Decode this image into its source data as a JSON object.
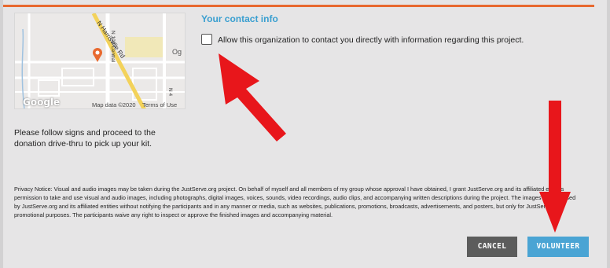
{
  "contact": {
    "title": "Your contact info",
    "checkbox_label": "Allow this organization to contact you directly with information regarding this project.",
    "checkbox_checked": false
  },
  "map": {
    "google_label": "Google",
    "map_data_label": "Map data ©2020",
    "terms_label": "Terms of Use",
    "streets": [
      "N Harrisville Rd",
      "N 100 Central",
      "N 4"
    ],
    "partial_label": "Og",
    "pin_color": "#e8692f"
  },
  "instructions": "Please follow signs and proceed to the donation drive-thru to pick up your kit.",
  "privacy_notice": "Privacy Notice: Visual and audio images may be taken during the JustServe.org project. On behalf of myself and all members of my group whose approval I have obtained, I grant JustServe.org and its affiliated entities permission to take and use visual and audio images, including photographs, digital images, voices, sounds, video recordings, audio clips, and accompanying written descriptions during the project. The images may be used by JustServe.org and its affiliated entities without notifying the participants and in any manner or media, such as websites, publications, promotions, broadcasts, advertisements, and posters, but only for JustServe.org promotional purposes. The participants waive any right to inspect or approve the finished images and accompanying material.",
  "buttons": {
    "cancel": "CANCEL",
    "volunteer": "VOLUNTEER"
  },
  "colors": {
    "accent_orange": "#e8692f",
    "title_blue": "#3a9fd0",
    "volunteer_blue": "#4aa4d4",
    "cancel_gray": "#5c5c5c",
    "annotation_red": "#e8161b"
  }
}
